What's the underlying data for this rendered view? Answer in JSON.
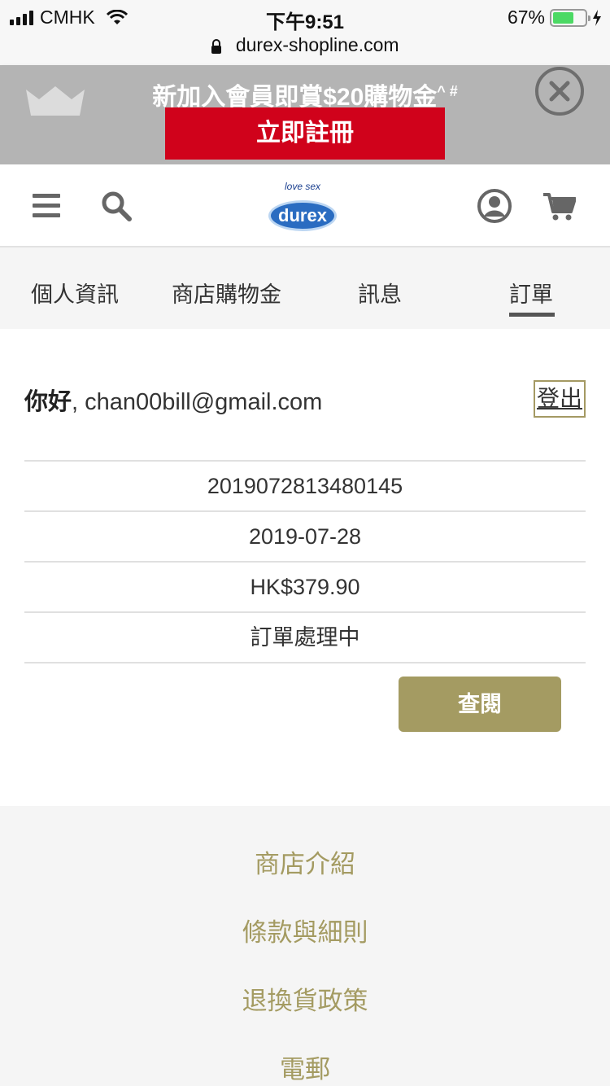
{
  "status_bar": {
    "carrier": "CMHK",
    "time": "下午9:51",
    "battery_percent_text": "67%",
    "battery_level": 0.67
  },
  "browser": {
    "url": "durex-shopline.com"
  },
  "promo": {
    "text": "新加入會員即賞$20購物金",
    "superscript": "^ #",
    "button_label": "立即註冊",
    "colors": {
      "banner_bg": "#b4b4b4",
      "button_bg": "#d0021b"
    }
  },
  "header": {
    "logo_tagline": "love sex",
    "logo_brand": "durex"
  },
  "tabs": [
    {
      "label": "個人資訊",
      "active": false
    },
    {
      "label": "商店購物金",
      "active": false
    },
    {
      "label": "訊息",
      "active": false
    },
    {
      "label": "訂單",
      "active": true
    }
  ],
  "account": {
    "greeting": "你好",
    "separator": ",",
    "email": "chan00bill@gmail.com",
    "logout_label": "登出"
  },
  "order": {
    "order_number": "2019072813480145",
    "date": "2019-07-28",
    "total": "HK$379.90",
    "status": "訂單處理中",
    "view_button_label": "查閱"
  },
  "footer": {
    "links": [
      "商店介紹",
      "條款與細則",
      "退換貨政策",
      "電郵"
    ]
  },
  "theme": {
    "accent_gold": "#a49b62"
  }
}
